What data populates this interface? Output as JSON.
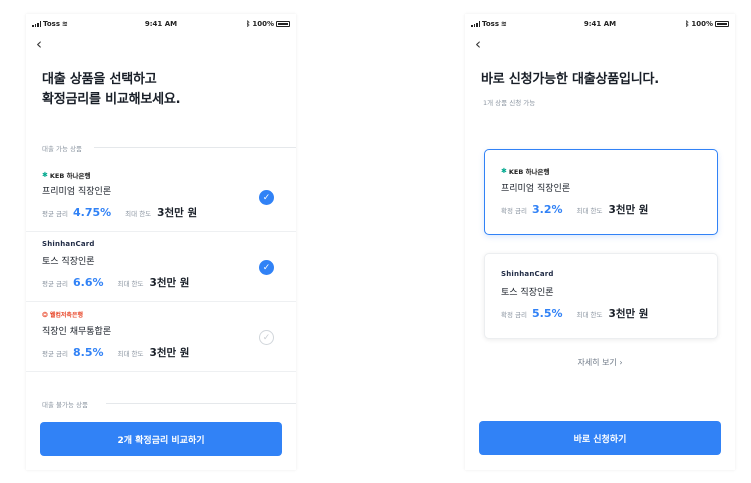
{
  "status": {
    "carrier": "Toss",
    "time": "9:41 AM",
    "battery": "100%"
  },
  "left": {
    "title_line1": "대출 상품을 선택하고",
    "title_line2": "확정금리를 비교해보세요.",
    "available_label": "대출 가능 상품",
    "unavailable_label": "대출 불가능 상품",
    "items": [
      {
        "bank": "KEB 하나은행",
        "product": "프리미엄 직장인론",
        "rate_label": "평균 금리",
        "rate": "4.75%",
        "limit_label": "최대 한도",
        "limit": "3천만 원",
        "checked": true
      },
      {
        "bank": "ShinhanCard",
        "product": "토스 직장인론",
        "rate_label": "평균 금리",
        "rate": "6.6%",
        "limit_label": "최대 한도",
        "limit": "3천만 원",
        "checked": true
      },
      {
        "bank": "웰컴저축은행",
        "product": "직장인 채무통합론",
        "rate_label": "평균 금리",
        "rate": "8.5%",
        "limit_label": "최대 한도",
        "limit": "3천만 원",
        "checked": false
      }
    ],
    "cta": "2개 확정금리 비교하기"
  },
  "right": {
    "title": "바로 신청가능한 대출상품입니다.",
    "subtitle": "1개 상품 신청 가능",
    "cards": [
      {
        "bank": "KEB 하나은행",
        "product": "프리미엄 직장인론",
        "rate_label": "확정 금리",
        "rate": "3.2%",
        "limit_label": "최대 한도",
        "limit": "3천만 원"
      },
      {
        "bank": "ShinhanCard",
        "product": "토스 직장인론",
        "rate_label": "확정 금리",
        "rate": "5.5%",
        "limit_label": "최대 한도",
        "limit": "3천만 원"
      }
    ],
    "detail_link": "자세히 보기",
    "cta": "바로 신청하기"
  },
  "icons": {
    "back": "chevron-left-icon",
    "check": "checkmark-icon",
    "link_arrow": "chevron-right-icon"
  },
  "colors": {
    "accent": "#3182f6",
    "text": "#191f28",
    "muted": "#8b95a1"
  }
}
